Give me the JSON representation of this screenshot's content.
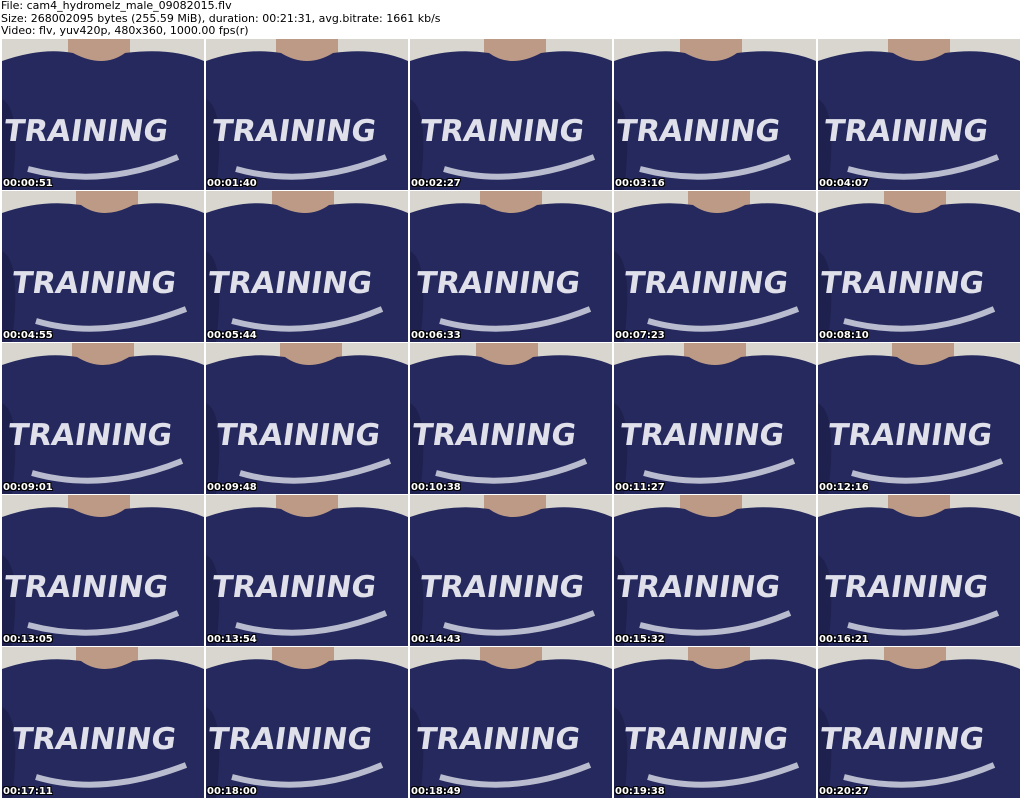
{
  "header": {
    "line1": "File: cam4_hydromelz_male_09082015.flv",
    "line2": "Size: 268002095 bytes (255.59 MiB), duration: 00:21:31, avg.bitrate: 1661 kb/s",
    "line3": "Video: flv, yuv420p, 480x360, 1000.00 fps(r)"
  },
  "shirt_text": "TRAINING",
  "colors": {
    "shirt": "#25295e",
    "shirt_shadow": "#1a1d45",
    "wall": "#d8d6cf",
    "skin": "#b98f78",
    "print": "#dfe0ea",
    "accent_star": "#d9683a"
  },
  "thumbnails": [
    {
      "time": "00:00:51"
    },
    {
      "time": "00:01:40"
    },
    {
      "time": "00:02:27"
    },
    {
      "time": "00:03:16"
    },
    {
      "time": "00:04:07"
    },
    {
      "time": "00:04:55"
    },
    {
      "time": "00:05:44"
    },
    {
      "time": "00:06:33"
    },
    {
      "time": "00:07:23"
    },
    {
      "time": "00:08:10"
    },
    {
      "time": "00:09:01"
    },
    {
      "time": "00:09:48"
    },
    {
      "time": "00:10:38"
    },
    {
      "time": "00:11:27"
    },
    {
      "time": "00:12:16"
    },
    {
      "time": "00:13:05"
    },
    {
      "time": "00:13:54"
    },
    {
      "time": "00:14:43"
    },
    {
      "time": "00:15:32"
    },
    {
      "time": "00:16:21"
    },
    {
      "time": "00:17:11"
    },
    {
      "time": "00:18:00"
    },
    {
      "time": "00:18:49"
    },
    {
      "time": "00:19:38"
    },
    {
      "time": "00:20:27"
    }
  ]
}
